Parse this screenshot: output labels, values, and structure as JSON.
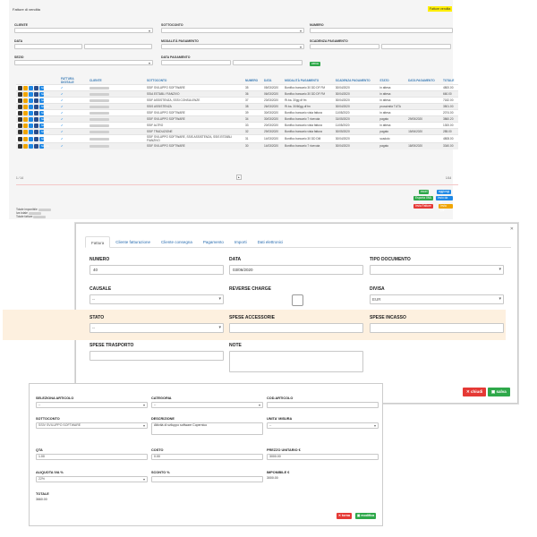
{
  "bg": {
    "title": "Fatture di vendita",
    "tab_label": "Fatture vendita",
    "filters": {
      "cliente": "CLIENTE",
      "sottoconto": "SOTTOCONTO",
      "numero": "NUMERO",
      "data": "DATA",
      "modalita": "MODALITÀ PAGAMENTO",
      "scadenza": "SCADENZA PAGAMENTO",
      "sezio": "SEZIO",
      "data_pagamento": "DATA PAGAMENTO",
      "search_btn": "cerca"
    },
    "columns": [
      "",
      "FATTURA DIGITALE",
      "CLIENTE",
      "SOTTOCONTO",
      "NUMERO",
      "DATA",
      "MODALITÀ PAGAMENTO",
      "SCADENZA PAGAMENTO",
      "STATO",
      "DATA PAGAMENTO",
      "TOTALE"
    ],
    "rows": [
      {
        "sottoconto": "SSIF SVILUPPO SOFTWARE",
        "numero": "35",
        "data": "05/03/2020",
        "modalita": "Bonifico bancario 30 DD DF FM",
        "scadenza": "30/04/2020",
        "stato": "in attesa",
        "datapag": "",
        "totale": "4800.00"
      },
      {
        "sottoconto": "SSIA ESTABLI FIANZIVO",
        "numero": "36",
        "data": "06/03/2020",
        "modalita": "Bonifico bancario 30 DD DF FM",
        "scadenza": "30/04/2020",
        "stato": "in attesa",
        "datapag": "",
        "totale": "660.00"
      },
      {
        "sottoconto": "SSIF ASSISTENZA, SSSI CONSULENZE",
        "numero": "37",
        "data": "23/03/2020",
        "modalita": "Ri.ba. 30gg df fm",
        "scadenza": "30/04/2020",
        "stato": "in attesa",
        "datapag": "",
        "totale": "7182.00"
      },
      {
        "sottoconto": "SSIS ASSISTENZA",
        "numero": "38",
        "data": "26/03/2020",
        "modalita": "Ri.ba. 30/60gg df fm",
        "scadenza": "30/04/2020",
        "stato": "prossimità TUTA",
        "datapag": "",
        "totale": "3501.00"
      },
      {
        "sottoconto": "SSIF SVILUPPO SOFTWARE",
        "numero": "39",
        "data": "30/03/2020",
        "modalita": "Bonifico bancario vista fattura",
        "scadenza": "11/05/2020",
        "stato": "in attesa",
        "datapag": "",
        "totale": "2074.00"
      },
      {
        "sottoconto": "SSIF SVILUPPO SOFTWARE",
        "numero": "34",
        "data": "30/03/2020",
        "modalita": "Bonifico bancario 7 ricevuta",
        "scadenza": "31/05/2020",
        "stato": "pagato",
        "datapag": "29/05/2020",
        "totale": "3860.20"
      },
      {
        "sottoconto": "SSIF ALTRO",
        "numero": "33",
        "data": "20/03/2020",
        "modalita": "Bonifico bancario vista fattura",
        "scadenza": "11/05/2020",
        "stato": "in attesa",
        "datapag": "",
        "totale": "1300.00"
      },
      {
        "sottoconto": "SSIF TRADUZIONE",
        "numero": "32",
        "data": "29/03/2020",
        "modalita": "Bonifico bancario vista fattura",
        "scadenza": "30/05/2020",
        "stato": "pagato",
        "datapag": "15/06/2020",
        "totale": "285.00"
      },
      {
        "sottoconto": "SSIF SVILUPPO SOFTWARE, SSIS ASSISTENZA, SSIS ESTABLI FIANZIVO",
        "numero": "31",
        "data": "14/03/2020",
        "modalita": "Bonifico bancario 30 DD DM",
        "scadenza": "30/04/2020",
        "stato": "scaduto",
        "datapag": "",
        "totale": "4808.00"
      },
      {
        "sottoconto": "SSIF SVILUPPO SOFTWARE",
        "numero": "30",
        "data": "14/03/2020",
        "modalita": "Bonifico bancario 7 ricevuta",
        "scadenza": "30/04/2020",
        "stato": "pagato",
        "datapag": "18/05/2020",
        "totale": "3340.00"
      }
    ],
    "row_btn": "fattura",
    "pager_left": "1 / 14",
    "pager_right": "1/14",
    "actions": [
      "excel",
      "aggiungi",
      "Esporta XML",
      "Invio da SDI",
      "Invia Fatture",
      "Invia pdf"
    ],
    "totals": [
      "Totale imponibile",
      "Iva totale",
      "Totale fatture"
    ]
  },
  "m1": {
    "tabs": [
      "Fattura",
      "Cliente fatturazione",
      "Cliente consegna",
      "Pagamento",
      "Importi",
      "Dati elettronici"
    ],
    "numero_label": "NUMERO",
    "numero_value": "40",
    "data_label": "DATA",
    "data_value": "03/06/2020",
    "tipo_label": "TIPO DOCUMENTO",
    "tipo_value": "",
    "causale_label": "CAUSALE",
    "causale_value": "--",
    "reverse_label": "REVERSE CHARGE",
    "divisa_label": "DIVISA",
    "divisa_value": "EUR",
    "stato_label": "STATO",
    "stato_value": "--",
    "spese_acc_label": "SPESE ACCESSORIE",
    "spese_inc_label": "SPESE INCASSO",
    "spese_tr_label": "SPESE TRASPORTO",
    "note_label": "NOTE",
    "chiudi": "chiudi",
    "salva": "salva"
  },
  "m2": {
    "articolo_label": "SELEZIONA ARTICOLO",
    "articolo_value": "--",
    "categoria_label": "CATEGORIA",
    "categoria_value": "--",
    "codice_label": "COD.ARTICOLO",
    "sottoconto_label": "SOTTOCONTO",
    "sottoconto_value": "SSIV SVILUPPO SOFTWARE",
    "descrizione_label": "DESCRIZIONE",
    "descrizione_value": "Attività di sviluppo software Copernico",
    "unita_label": "UNITA' MISURA",
    "unita_value": "--",
    "qta_label": "QTA",
    "qta_value": "1.00",
    "sconto_label": "COSTO",
    "sconto_value": "0.00",
    "prezzo_label": "PREZZO UNITARIO €",
    "prezzo_value": "3000.00",
    "aliquota_label": "ALIQUOTA IVA %",
    "aliquota_value": "22%",
    "sconto2_label": "SCONTO %",
    "imponibile_label": "IMPONIBILE €",
    "imponibile_value": "3000.00",
    "totale_label": "TOTALE",
    "totale_value": "3660.00",
    "chiudi": "torna",
    "modifica": "modifica"
  }
}
